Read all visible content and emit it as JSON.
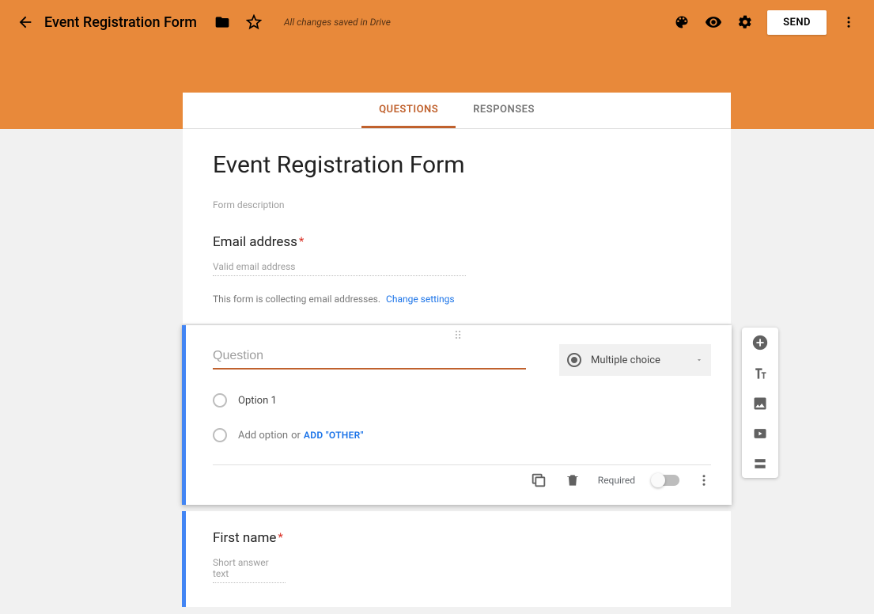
{
  "header": {
    "doc_title": "Event Registration Form",
    "save_status": "All changes saved in Drive",
    "send_label": "SEND"
  },
  "tabs": {
    "questions": "QUESTIONS",
    "responses": "RESPONSES"
  },
  "form": {
    "title": "Event Registration Form",
    "description_placeholder": "Form description"
  },
  "email_block": {
    "label": "Email address",
    "placeholder": "Valid email address",
    "collect_note": "This form is collecting email addresses.",
    "change_link": "Change settings"
  },
  "active_question": {
    "question_placeholder": "Question",
    "type_label": "Multiple choice",
    "option1": "Option 1",
    "add_option": "Add option",
    "or": "or",
    "add_other": "ADD \"OTHER\"",
    "required_label": "Required"
  },
  "next_question": {
    "label": "First name",
    "placeholder": "Short answer text"
  }
}
